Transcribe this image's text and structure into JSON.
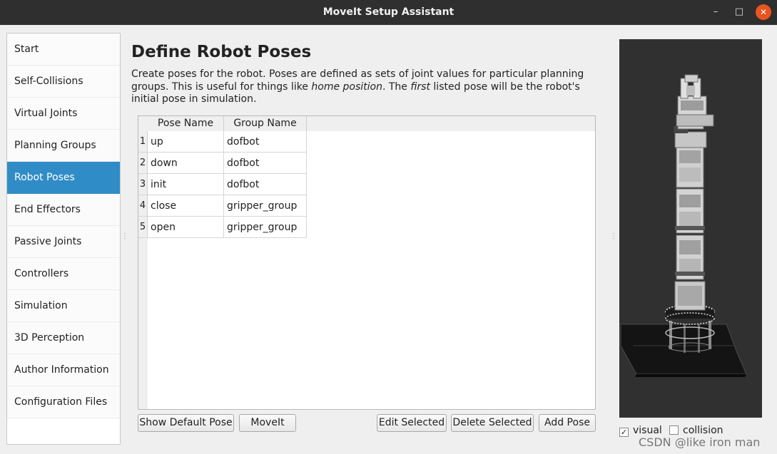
{
  "window": {
    "title": "MoveIt Setup Assistant",
    "minimize_glyph": "–",
    "maximize_glyph": "□",
    "close_glyph": "✕"
  },
  "sidebar": {
    "items": [
      {
        "label": "Start"
      },
      {
        "label": "Self-Collisions"
      },
      {
        "label": "Virtual Joints"
      },
      {
        "label": "Planning Groups"
      },
      {
        "label": "Robot Poses",
        "active": true
      },
      {
        "label": "End Effectors"
      },
      {
        "label": "Passive Joints"
      },
      {
        "label": "Controllers"
      },
      {
        "label": "Simulation"
      },
      {
        "label": "3D Perception"
      },
      {
        "label": "Author Information"
      },
      {
        "label": "Configuration Files"
      }
    ]
  },
  "main": {
    "heading": "Define Robot Poses",
    "description": {
      "part1": "Create poses for the robot. Poses are defined as sets of joint values for particular planning groups. This is useful for things like ",
      "em1": "home position",
      "part2": ". The ",
      "em2": "first",
      "part3": " listed pose will be the robot's initial pose in simulation."
    },
    "table": {
      "headers": [
        "Pose Name",
        "Group Name"
      ],
      "rows": [
        {
          "num": "1",
          "pose": "up",
          "group": "dofbot"
        },
        {
          "num": "2",
          "pose": "down",
          "group": "dofbot"
        },
        {
          "num": "3",
          "pose": "init",
          "group": "dofbot"
        },
        {
          "num": "4",
          "pose": "close",
          "group": "gripper_group"
        },
        {
          "num": "5",
          "pose": "open",
          "group": "gripper_group"
        }
      ]
    },
    "buttons": {
      "show_default_pose": "Show Default Pose",
      "moveit": "MoveIt",
      "edit_selected": "Edit Selected",
      "delete_selected": "Delete Selected",
      "add_pose": "Add Pose"
    }
  },
  "viewer": {
    "visual_label": "visual",
    "visual_checked": true,
    "collision_label": "collision",
    "collision_checked": false,
    "background_color": "#303030"
  },
  "watermark": "CSDN @like iron man",
  "colors": {
    "accent": "#308cc6",
    "close_button": "#e95420",
    "titlebar": "#2f2f2f"
  }
}
